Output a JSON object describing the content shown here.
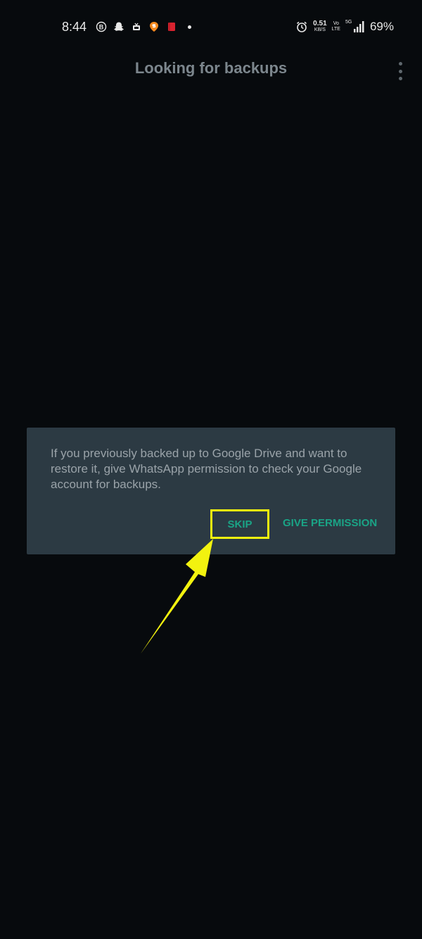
{
  "status_bar": {
    "time": "8:44",
    "left_icons": [
      "b-circle-icon",
      "snapchat-icon",
      "tv-icon",
      "swiggy-icon",
      "red-book-icon"
    ],
    "net_speed_value": "0.51",
    "net_speed_unit": "KB/S",
    "volte_top": "Vo",
    "volte_bottom": "LTE",
    "network_type": "5G",
    "battery": "69%"
  },
  "header": {
    "title": "Looking for backups"
  },
  "dialog": {
    "message": "If you previously backed up to Google Drive and want to restore it, give WhatsApp permission to check your Google account for backups.",
    "skip_label": "SKIP",
    "permission_label": "GIVE PERMISSION"
  },
  "colors": {
    "background": "#070a0d",
    "dialog": "#2c3a43",
    "accent_green": "#1aa486",
    "highlight_yellow": "#f2f20f"
  }
}
